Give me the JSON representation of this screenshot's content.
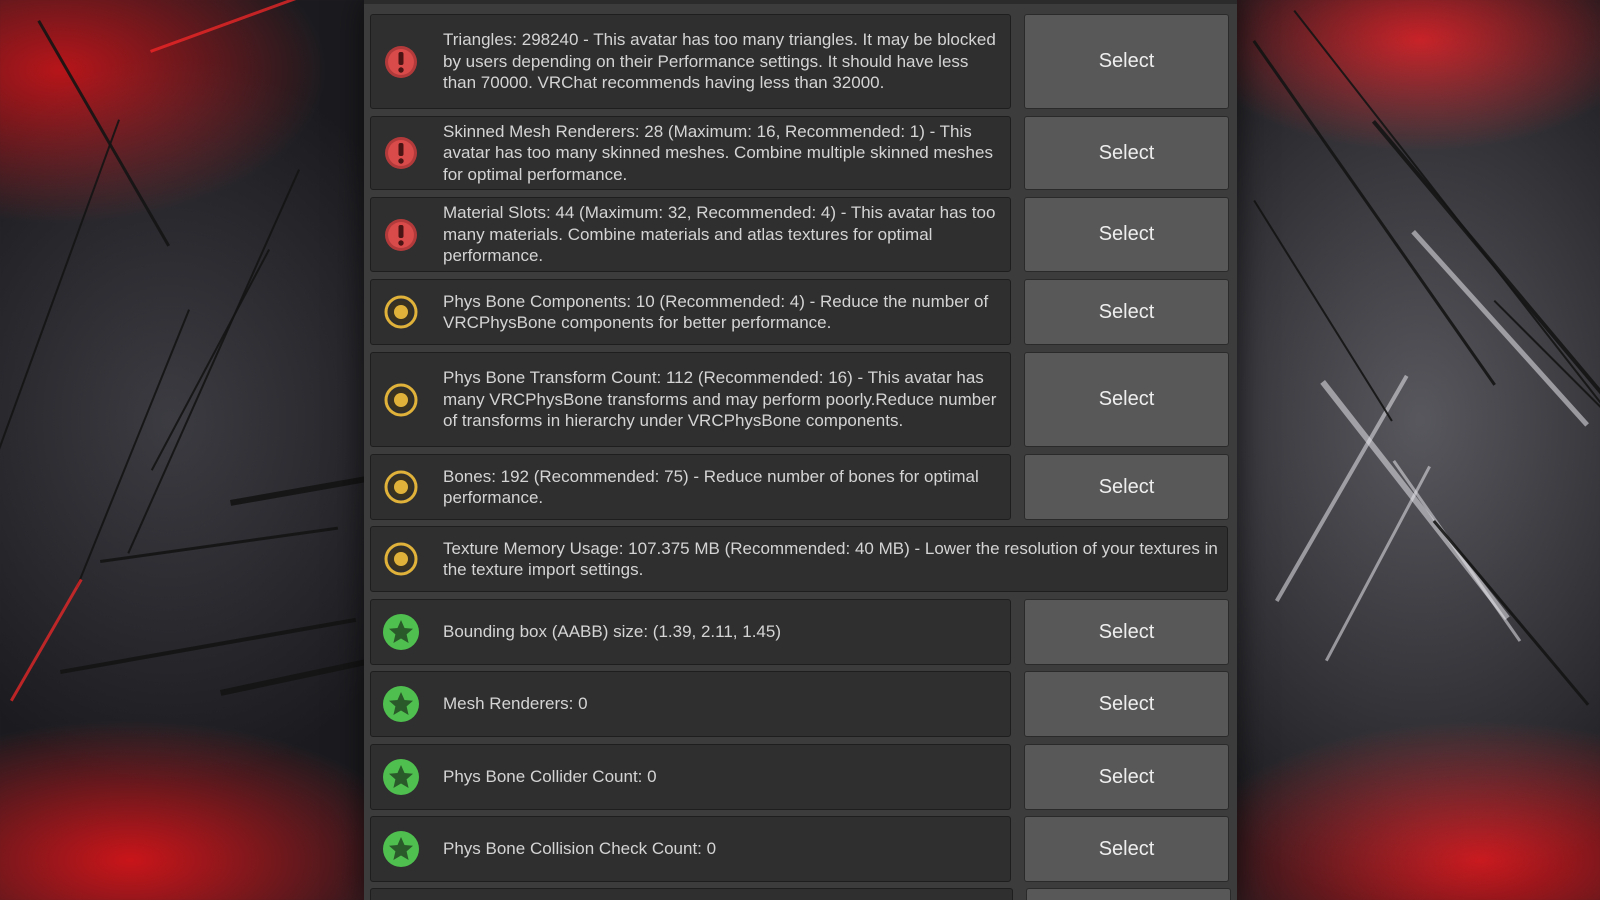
{
  "colors": {
    "error": "#d94a4a",
    "warning": "#e0b23a",
    "good": "#4fbf4f",
    "panel": "#3c3c3c",
    "message_bg": "#2f2f2f",
    "button_bg": "#585858"
  },
  "rows": [
    {
      "icon": "error-icon",
      "level": "error",
      "text": "Triangles: 298240 - This avatar has too many triangles. It may be blocked by users depending on their Performance settings. It should have less than 70000. VRChat recommends having less than 32000.",
      "button": "Select"
    },
    {
      "icon": "error-icon",
      "level": "error",
      "text": "Skinned Mesh Renderers: 28 (Maximum: 16, Recommended: 1) - This avatar has too many skinned meshes. Combine multiple skinned meshes for optimal performance.",
      "button": "Select"
    },
    {
      "icon": "error-icon",
      "level": "error",
      "text": "Material Slots: 44 (Maximum: 32, Recommended: 4) - This avatar has too many materials. Combine materials and atlas textures for optimal performance.",
      "button": "Select"
    },
    {
      "icon": "warning-icon",
      "level": "warning",
      "text": "Phys Bone Components: 10 (Recommended: 4) - Reduce the number of VRCPhysBone components for better performance.",
      "button": "Select"
    },
    {
      "icon": "warning-icon",
      "level": "warning",
      "text": "Phys Bone Transform Count: 112 (Recommended: 16) - This avatar has many VRCPhysBone transforms and may perform poorly.Reduce number of transforms in hierarchy under VRCPhysBone components.",
      "button": "Select"
    },
    {
      "icon": "warning-icon",
      "level": "warning",
      "text": "Bones: 192 (Recommended: 75) - Reduce number of bones for optimal performance.",
      "button": "Select"
    },
    {
      "icon": "warning-icon",
      "level": "warning",
      "text": "Texture Memory Usage: 107.375 MB (Recommended: 40 MB) - Lower the resolution of your textures in the texture import settings.",
      "button": null
    },
    {
      "icon": "star-icon",
      "level": "good",
      "text": "Bounding box (AABB) size: (1.39, 2.11, 1.45)",
      "button": "Select"
    },
    {
      "icon": "star-icon",
      "level": "good",
      "text": "Mesh Renderers: 0",
      "button": "Select"
    },
    {
      "icon": "star-icon",
      "level": "good",
      "text": "Phys Bone Collider Count: 0",
      "button": "Select"
    },
    {
      "icon": "star-icon",
      "level": "good",
      "text": "Phys Bone Collision Check Count: 0",
      "button": "Select"
    }
  ]
}
